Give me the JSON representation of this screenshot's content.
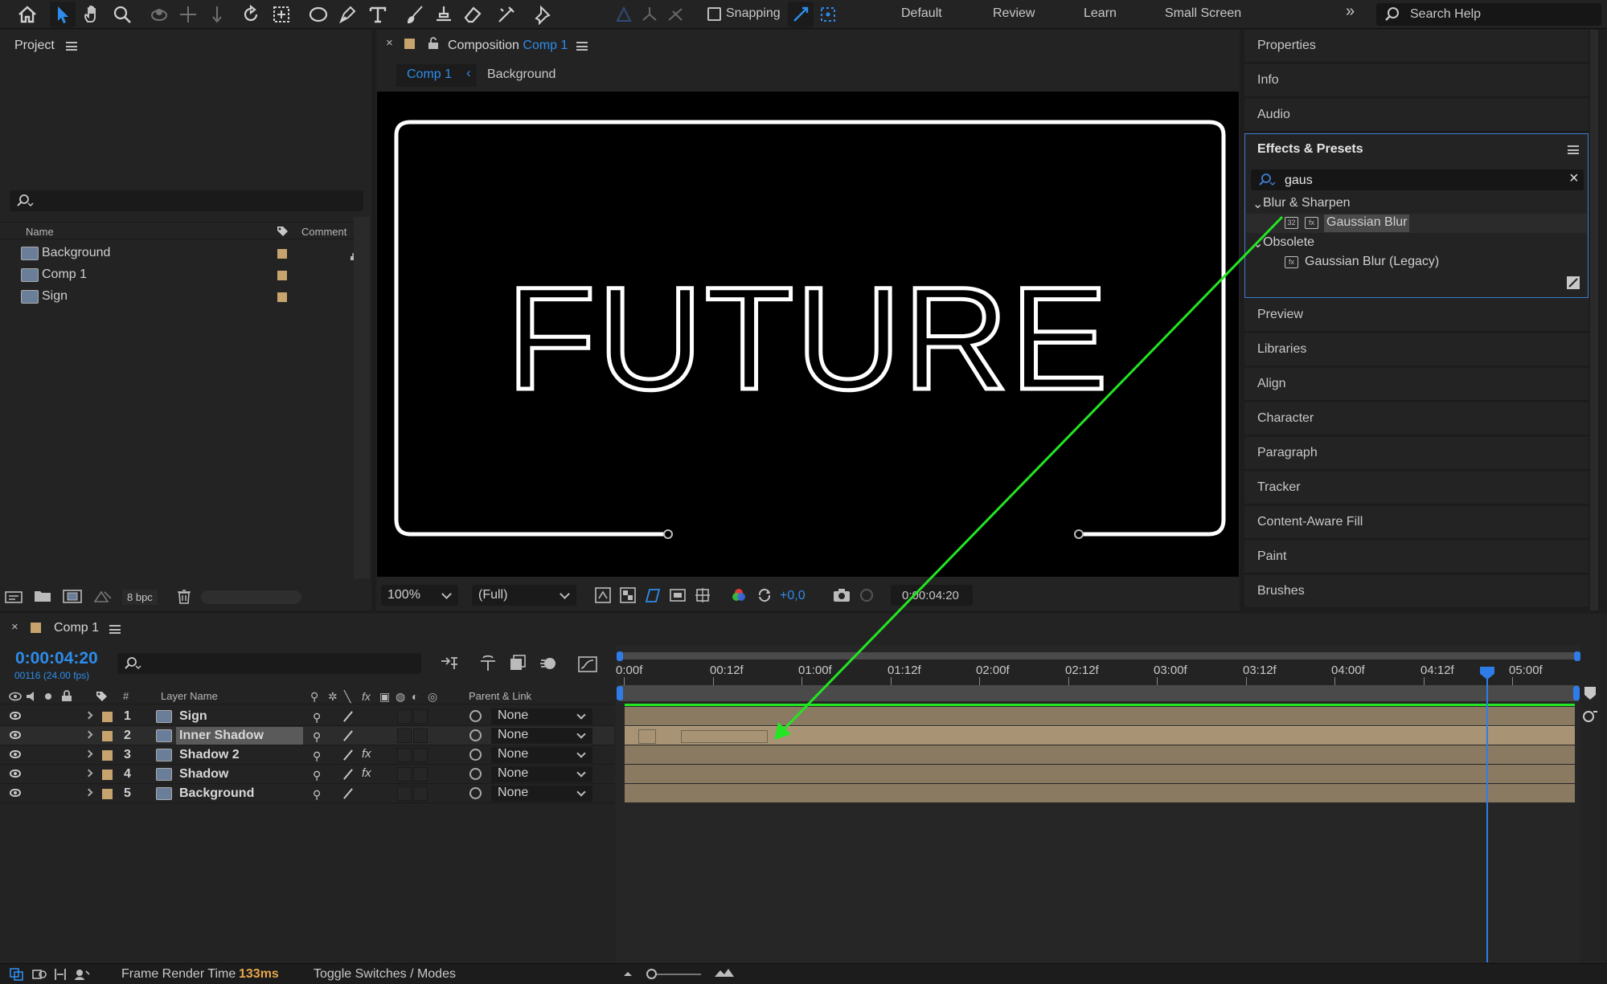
{
  "toolbar": {
    "snapping_label": "Snapping",
    "workspaces": [
      "Default",
      "Review",
      "Learn",
      "Small Screen"
    ],
    "search_help_label": "Search Help"
  },
  "project": {
    "title": "Project",
    "col_name": "Name",
    "col_comment": "Comment",
    "items": [
      "Background",
      "Comp 1",
      "Sign"
    ],
    "bpc_label": "8 bpc"
  },
  "composition": {
    "tab_prefix": "Composition",
    "tab_name": "Comp 1",
    "breadcrumb_comp": "Comp 1",
    "breadcrumb_layer": "Background",
    "viewer_text": "FUTURE",
    "zoom": "100%",
    "resolution": "(Full)",
    "exposure": "+0,0",
    "timecode": "0:00:04:20"
  },
  "right_panels": {
    "top": [
      "Properties",
      "Info",
      "Audio"
    ],
    "bottom": [
      "Preview",
      "Libraries",
      "Align",
      "Character",
      "Paragraph",
      "Tracker",
      "Content-Aware Fill",
      "Paint",
      "Brushes"
    ]
  },
  "effects": {
    "title": "Effects & Presets",
    "search_value": "gaus",
    "group1": "Blur & Sharpen",
    "group1_item": "Gaussian Blur",
    "group2": "Obsolete",
    "group2_item": "Gaussian Blur (Legacy)",
    "badge_32": "32"
  },
  "timeline": {
    "comp_name": "Comp 1",
    "timecode": "0:00:04:20",
    "fps": "00116 (24.00 fps)",
    "col_layer_name": "Layer Name",
    "col_hash": "#",
    "col_parent": "Parent & Link",
    "ruler_labels": [
      "0:00f",
      "00:12f",
      "01:00f",
      "01:12f",
      "02:00f",
      "02:12f",
      "03:00f",
      "03:12f",
      "04:00f",
      "04:12f",
      "05:00f"
    ],
    "layers": [
      {
        "num": "1",
        "name": "Sign",
        "parent": "None",
        "fx": false
      },
      {
        "num": "2",
        "name": "Inner Shadow",
        "parent": "None",
        "fx": false
      },
      {
        "num": "3",
        "name": "Shadow 2",
        "parent": "None",
        "fx": true
      },
      {
        "num": "4",
        "name": "Shadow",
        "parent": "None",
        "fx": true
      },
      {
        "num": "5",
        "name": "Background",
        "parent": "None",
        "fx": false
      }
    ]
  },
  "status": {
    "frame_render_label": "Frame Render Time",
    "frame_render_value": "133ms",
    "toggle_label": "Toggle Switches / Modes"
  },
  "colors": {
    "accent_blue": "#2d8ceb",
    "label_tan": "#c7a46e",
    "annotation_green": "#22e622"
  }
}
